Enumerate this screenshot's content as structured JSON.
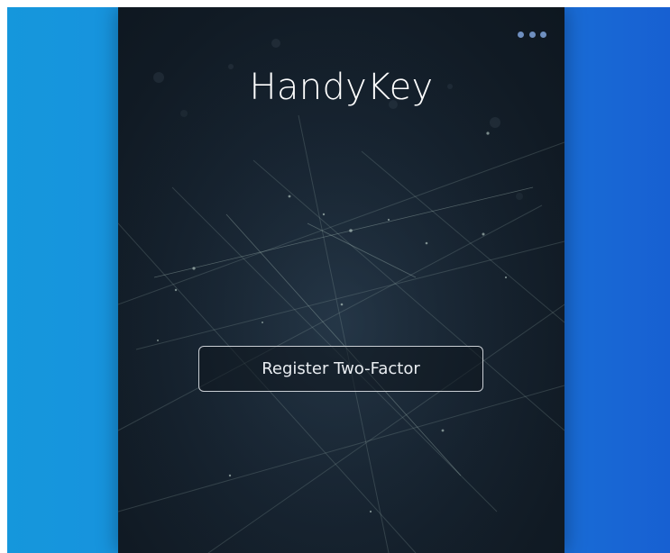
{
  "app": {
    "title": "HandyKey"
  },
  "header": {
    "menu_icon": "more-horizontal-icon"
  },
  "main": {
    "register_button_label": "Register Two-Factor"
  },
  "colors": {
    "background_left": "#1597dc",
    "background_right": "#1760d2",
    "panel": "#131f2b",
    "menu_dots": "#6f8fbf",
    "button_border": "#c9ced4",
    "text": "#ffffff"
  }
}
